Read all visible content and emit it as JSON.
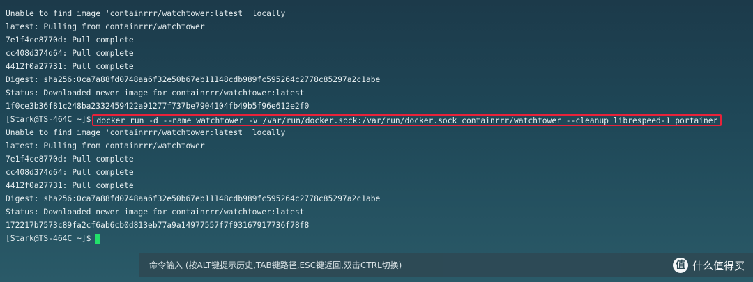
{
  "terminal": {
    "lines_before": [
      "Unable to find image 'containrrr/watchtower:latest' locally",
      "latest: Pulling from containrrr/watchtower",
      "7e1f4ce8770d: Pull complete",
      "cc408d374d64: Pull complete",
      "4412f0a27731: Pull complete",
      "Digest: sha256:0ca7a88fd0748aa6f32e50b67eb11148cdb989fc595264c2778c85297a2c1abe",
      "Status: Downloaded newer image for containrrr/watchtower:latest",
      "1f0ce3b36f81c248ba2332459422a91277f737be7904104fb49b5f96e612e2f0"
    ],
    "prompt": "[Stark@TS-464C ~]$",
    "highlighted_command": "docker run -d --name watchtower -v /var/run/docker.sock:/var/run/docker.sock containrrr/watchtower --cleanup librespeed-1 portainer",
    "lines_after": [
      "Unable to find image 'containrrr/watchtower:latest' locally",
      "latest: Pulling from containrrr/watchtower",
      "7e1f4ce8770d: Pull complete",
      "cc408d374d64: Pull complete",
      "4412f0a27731: Pull complete",
      "Digest: sha256:0ca7a88fd0748aa6f32e50b67eb11148cdb989fc595264c2778c85297a2c1abe",
      "Status: Downloaded newer image for containrrr/watchtower:latest",
      "172217b7573c89fa2cf6ab6cb0d813eb77a9a14977557f7f93167917736f78f8"
    ],
    "final_prompt": "[Stark@TS-464C ~]$"
  },
  "input_bar": {
    "hint": "命令输入 (按ALT键提示历史,TAB键路径,ESC键返回,双击CTRL切换)"
  },
  "watermark": {
    "logo_glyph": "值",
    "text": "什么值得买"
  },
  "colors": {
    "highlight_border": "#e8223a",
    "cursor": "#22e06a"
  }
}
